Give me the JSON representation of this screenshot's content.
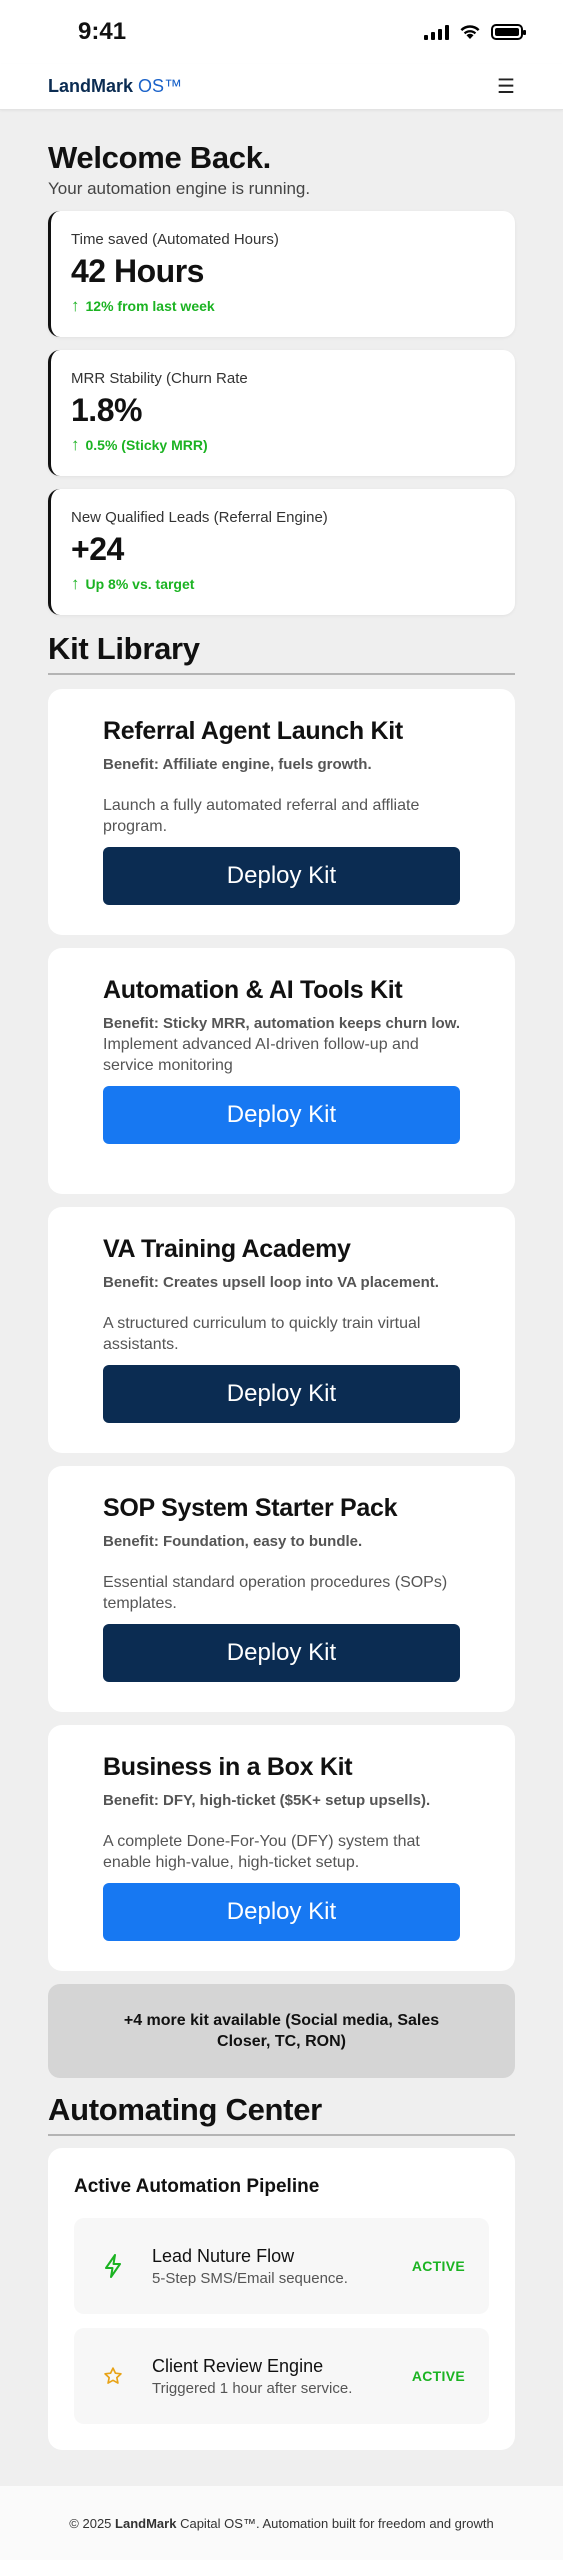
{
  "status_bar": {
    "time": "9:41"
  },
  "header": {
    "brand": "LandMark",
    "brand_suffix": "OS™"
  },
  "welcome": {
    "title": "Welcome Back.",
    "subtitle": "Your automation engine is running."
  },
  "metrics": [
    {
      "label": "Time saved (Automated Hours)",
      "value": "42 Hours",
      "change": "12% from last week"
    },
    {
      "label": "MRR Stability (Churn Rate",
      "value": "1.8%",
      "change": "0.5% (Sticky MRR)"
    },
    {
      "label": "New Qualified Leads (Referral Engine)",
      "value": "+24",
      "change": "Up 8% vs. target"
    }
  ],
  "kit_library": {
    "title": "Kit Library",
    "deploy_label": "Deploy Kit",
    "colors": {
      "dark": "#0b2c52",
      "blue": "#1778f2"
    },
    "kits": [
      {
        "title": "Referral Agent Launch Kit",
        "benefit": "Benefit: Affiliate engine, fuels growth.",
        "description": "Launch a fully automated referral and affliate program.",
        "button_style": "dark"
      },
      {
        "title": "Automation & AI Tools Kit",
        "benefit": "Benefit: Sticky MRR, automation keeps churn low.",
        "description": "Implement advanced AI-driven follow-up and service monitoring",
        "button_style": "blue"
      },
      {
        "title": "VA Training Academy",
        "benefit": "Benefit: Creates upsell loop into VA placement.",
        "description": "A structured curriculum to quickly train virtual assistants.",
        "button_style": "dark"
      },
      {
        "title": "SOP System Starter Pack",
        "benefit": "Benefit: Foundation, easy to bundle.",
        "description": "Essential standard operation procedures (SOPs) templates.",
        "button_style": "dark"
      },
      {
        "title": "Business in a Box Kit",
        "benefit": "Benefit: DFY, high-ticket ($5K+ setup upsells).",
        "description": "A complete Done-For-You (DFY) system that enable high-value, high-ticket setup.",
        "button_style": "blue"
      }
    ],
    "more": "+4 more kit available (Social media, Sales Closer, TC, RON)"
  },
  "automation_center": {
    "title": "Automating Center",
    "pipeline_title": "Active Automation Pipeline",
    "items": [
      {
        "name": "Lead Nuture Flow",
        "description": "5-Step SMS/Email sequence.",
        "status": "ACTIVE",
        "icon": "lightning-icon"
      },
      {
        "name": "Client Review Engine",
        "description": "Triggered 1 hour after service.",
        "status": "ACTIVE",
        "icon": "star-icon"
      }
    ]
  },
  "footer": {
    "prefix": "© 2025",
    "brand": "LandMark",
    "suffix": "Capital OS™. Automation built for freedom and growth"
  }
}
